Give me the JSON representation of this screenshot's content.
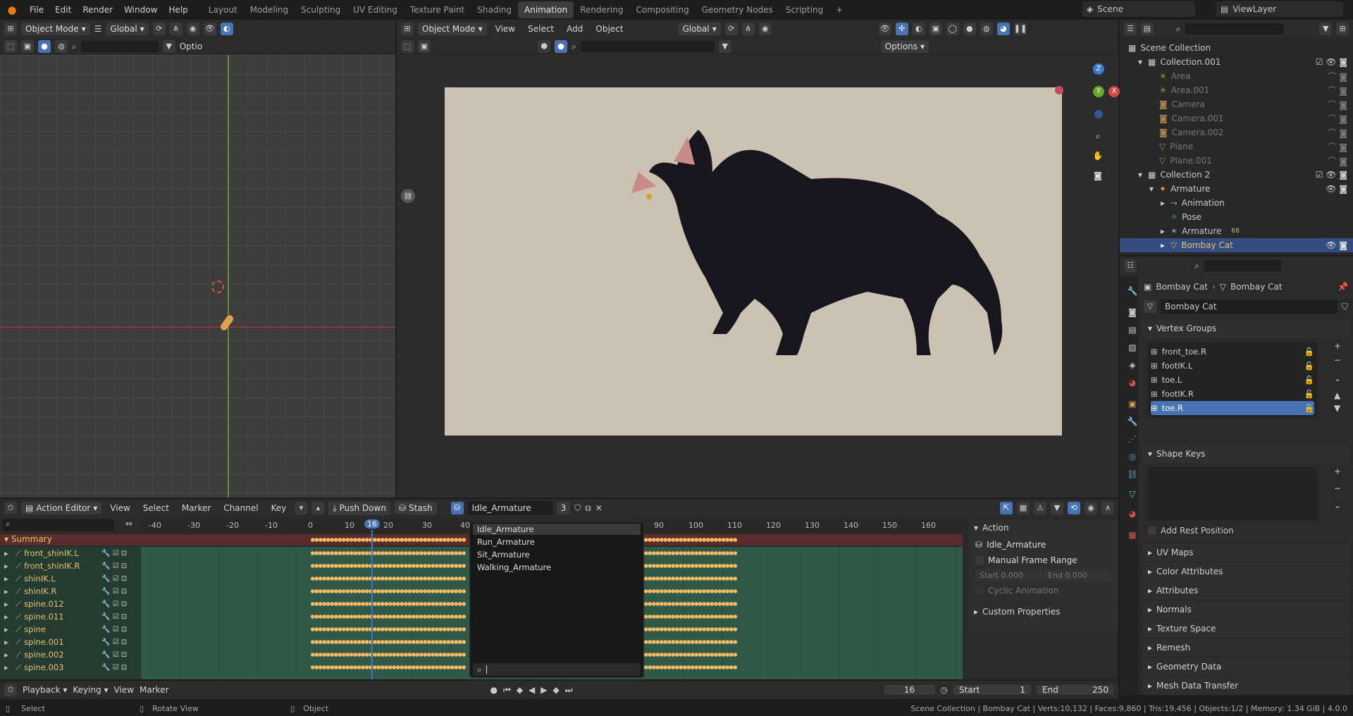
{
  "topbar": {
    "menus": [
      "File",
      "Edit",
      "Render",
      "Window",
      "Help"
    ],
    "workspaces": [
      "Layout",
      "Modeling",
      "Sculpting",
      "UV Editing",
      "Texture Paint",
      "Shading",
      "Animation",
      "Rendering",
      "Compositing",
      "Geometry Nodes",
      "Scripting"
    ],
    "active_workspace": "Animation",
    "add_tab": "+",
    "scene": "Scene",
    "viewlayer": "ViewLayer"
  },
  "left_viewport": {
    "mode": "Object Mode",
    "orientation": "Global",
    "options": "Optio"
  },
  "main_viewport": {
    "mode": "Object Mode",
    "menus": [
      "View",
      "Select",
      "Add",
      "Object"
    ],
    "orientation": "Global",
    "options": "Options",
    "gizmo": {
      "z": "Z",
      "y": "Y",
      "x": "X"
    }
  },
  "outliner": {
    "title": "Scene Collection",
    "items": [
      {
        "label": "Collection.001",
        "depth": 1
      },
      {
        "label": "Area",
        "depth": 2
      },
      {
        "label": "Area.001",
        "depth": 2
      },
      {
        "label": "Camera",
        "depth": 2
      },
      {
        "label": "Camera.001",
        "depth": 2
      },
      {
        "label": "Camera.002",
        "depth": 2
      },
      {
        "label": "Plane",
        "depth": 2
      },
      {
        "label": "Plane.001",
        "depth": 2
      },
      {
        "label": "Collection 2",
        "depth": 1
      },
      {
        "label": "Armature",
        "depth": 2
      },
      {
        "label": "Animation",
        "depth": 3
      },
      {
        "label": "Pose",
        "depth": 3
      },
      {
        "label": "Armature",
        "depth": 3
      },
      {
        "label": "Bombay Cat",
        "depth": 3
      }
    ],
    "armature_badge": "68"
  },
  "properties": {
    "breadcrumb_left": "Bombay Cat",
    "breadcrumb_right": "Bombay Cat",
    "mesh_name": "Bombay Cat",
    "vertex_groups_title": "Vertex Groups",
    "vertex_groups": [
      "front_toe.R",
      "footIK.L",
      "toe.L",
      "footIK.R",
      "toe.R"
    ],
    "selected_group": "toe.R",
    "shape_keys_title": "Shape Keys",
    "add_rest_position": "Add Rest Position",
    "panels": [
      "UV Maps",
      "Color Attributes",
      "Attributes",
      "Normals",
      "Texture Space",
      "Remesh",
      "Geometry Data",
      "Mesh Data Transfer"
    ]
  },
  "action_editor": {
    "mode": "Action Editor",
    "menus": [
      "View",
      "Select",
      "Marker",
      "Channel",
      "Key"
    ],
    "push_down": "Push Down",
    "stash": "Stash",
    "action_name": "Idle_Armature",
    "users": "3",
    "ruler": [
      "-40",
      "-30",
      "-20",
      "-10",
      "0",
      "10",
      "16",
      "20",
      "30",
      "40",
      "90",
      "100",
      "110",
      "120",
      "130",
      "140",
      "150",
      "160"
    ],
    "current_frame": "16",
    "summary": "Summary",
    "channels": [
      "front_shinIK.L",
      "front_shinIK.R",
      "shinIK.L",
      "shinIK.R",
      "spine.012",
      "spine.011",
      "spine",
      "spine.001",
      "spine.002",
      "spine.003"
    ],
    "dropdown_items": [
      "Idle_Armature",
      "Run_Armature",
      "Sit_Armature",
      "Walking_Armature"
    ],
    "side_panel": {
      "title": "Action",
      "action": "Idle_Armature",
      "manual_frame_range": "Manual Frame Range",
      "start_label": "Start",
      "start_value": "0.000",
      "end_label": "End",
      "end_value": "0.000",
      "cyclic": "Cyclic Animation",
      "custom_properties": "Custom Properties"
    }
  },
  "playback": {
    "menus": [
      "Playback",
      "Keying",
      "View",
      "Marker"
    ],
    "frame": "16",
    "start_label": "Start",
    "start": "1",
    "end_label": "End",
    "end": "250"
  },
  "statusbar": {
    "select": "Select",
    "rotate": "Rotate View",
    "object": "Object",
    "info": "Scene Collection | Bombay Cat | Verts:10,132 | Faces:9,860 | Tris:19,456 | Objects:1/2 | Memory: 1.34 GiB | 4.0.0"
  },
  "colors": {
    "accent": "#4772b3",
    "active_tab": "#3d3d3d",
    "keyframe": "#f0b860",
    "channel_bg": "#2f5a4a"
  }
}
